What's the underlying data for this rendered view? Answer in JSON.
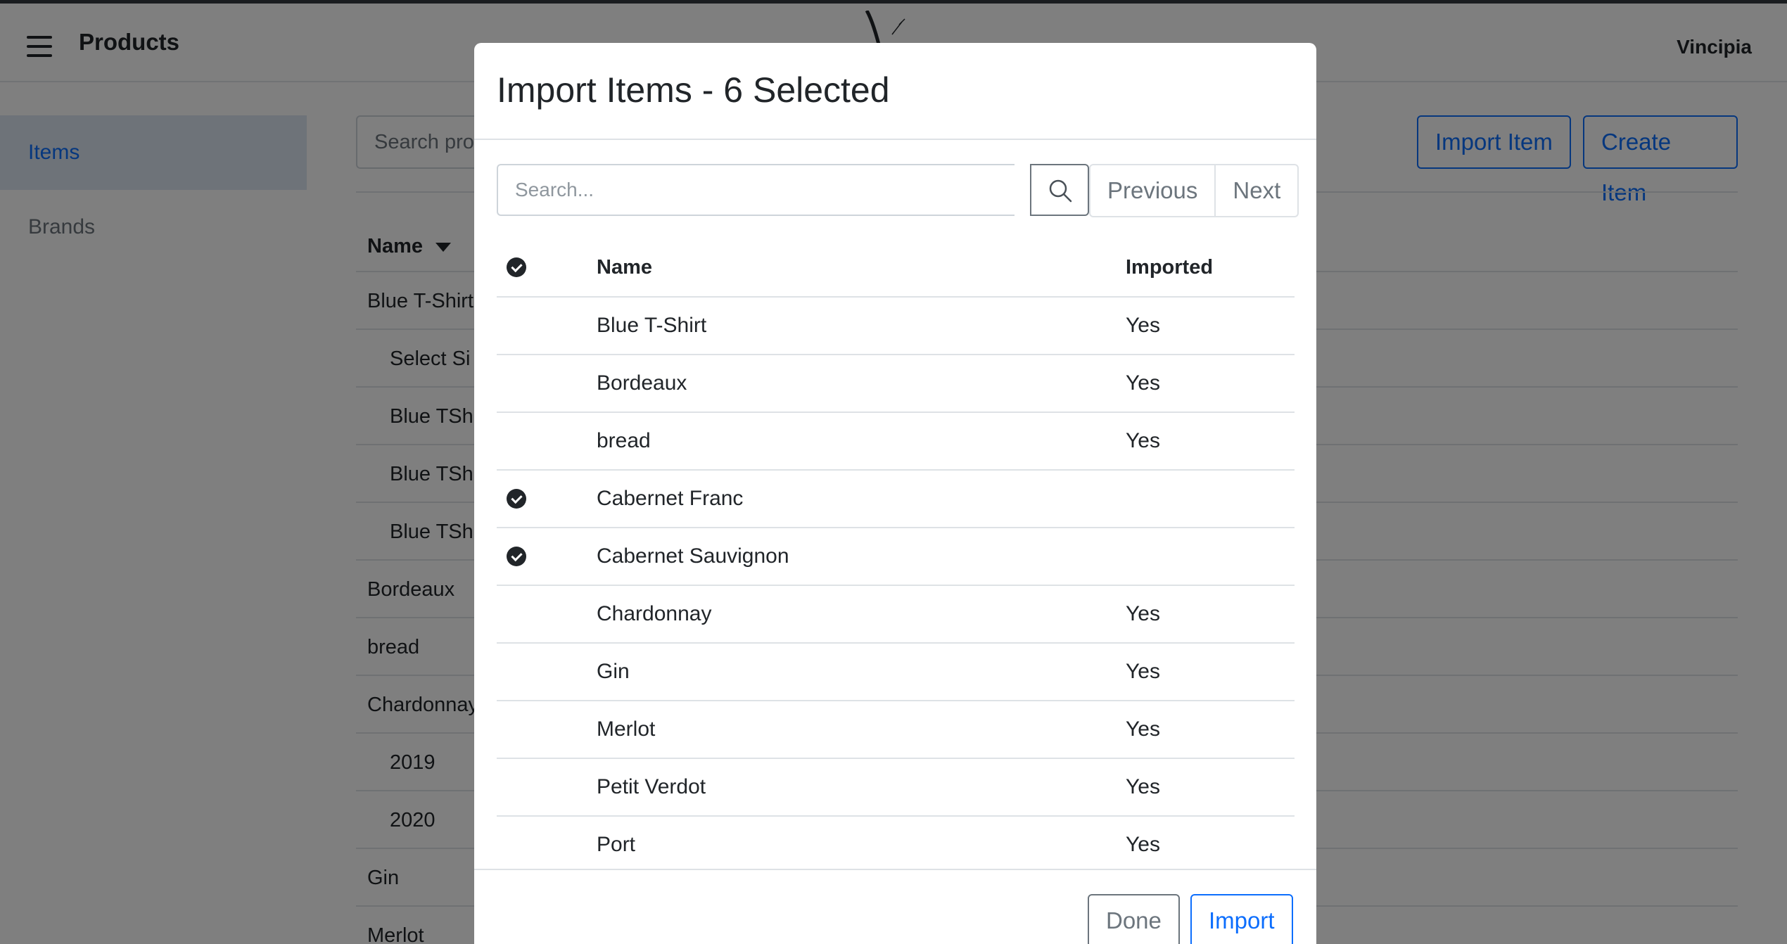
{
  "navbar": {
    "title": "Products",
    "user": "Vincipia"
  },
  "sidebar": {
    "items": [
      {
        "label": "Items"
      },
      {
        "label": "Brands"
      }
    ]
  },
  "main": {
    "search_placeholder": "Search pro",
    "import_button": "Import Item",
    "create_button": "Create Item",
    "table_header": "Name",
    "rows": [
      {
        "name": "Blue T-Shirt"
      },
      {
        "name": "Select Si"
      },
      {
        "name": "Blue TSh"
      },
      {
        "name": "Blue TSh"
      },
      {
        "name": "Blue TSh"
      },
      {
        "name": "Bordeaux"
      },
      {
        "name": "bread"
      },
      {
        "name": "Chardonnay"
      },
      {
        "name": "2019"
      },
      {
        "name": "2020"
      },
      {
        "name": "Gin"
      },
      {
        "name": "Merlot"
      }
    ]
  },
  "modal": {
    "title": "Import Items - 6 Selected",
    "search_placeholder": "Search...",
    "prev_label": "Previous",
    "next_label": "Next",
    "columns": {
      "name": "Name",
      "imported": "Imported"
    },
    "rows": [
      {
        "name": "Blue T-Shirt",
        "imported": "Yes"
      },
      {
        "name": "Bordeaux",
        "imported": "Yes"
      },
      {
        "name": "bread",
        "imported": "Yes"
      },
      {
        "name": "Cabernet Franc",
        "imported": ""
      },
      {
        "name": "Cabernet Sauvignon",
        "imported": ""
      },
      {
        "name": "Chardonnay",
        "imported": "Yes"
      },
      {
        "name": "Gin",
        "imported": "Yes"
      },
      {
        "name": "Merlot",
        "imported": "Yes"
      },
      {
        "name": "Petit Verdot",
        "imported": "Yes"
      },
      {
        "name": "Port",
        "imported": "Yes"
      }
    ],
    "done_label": "Done",
    "import_label": "Import"
  }
}
